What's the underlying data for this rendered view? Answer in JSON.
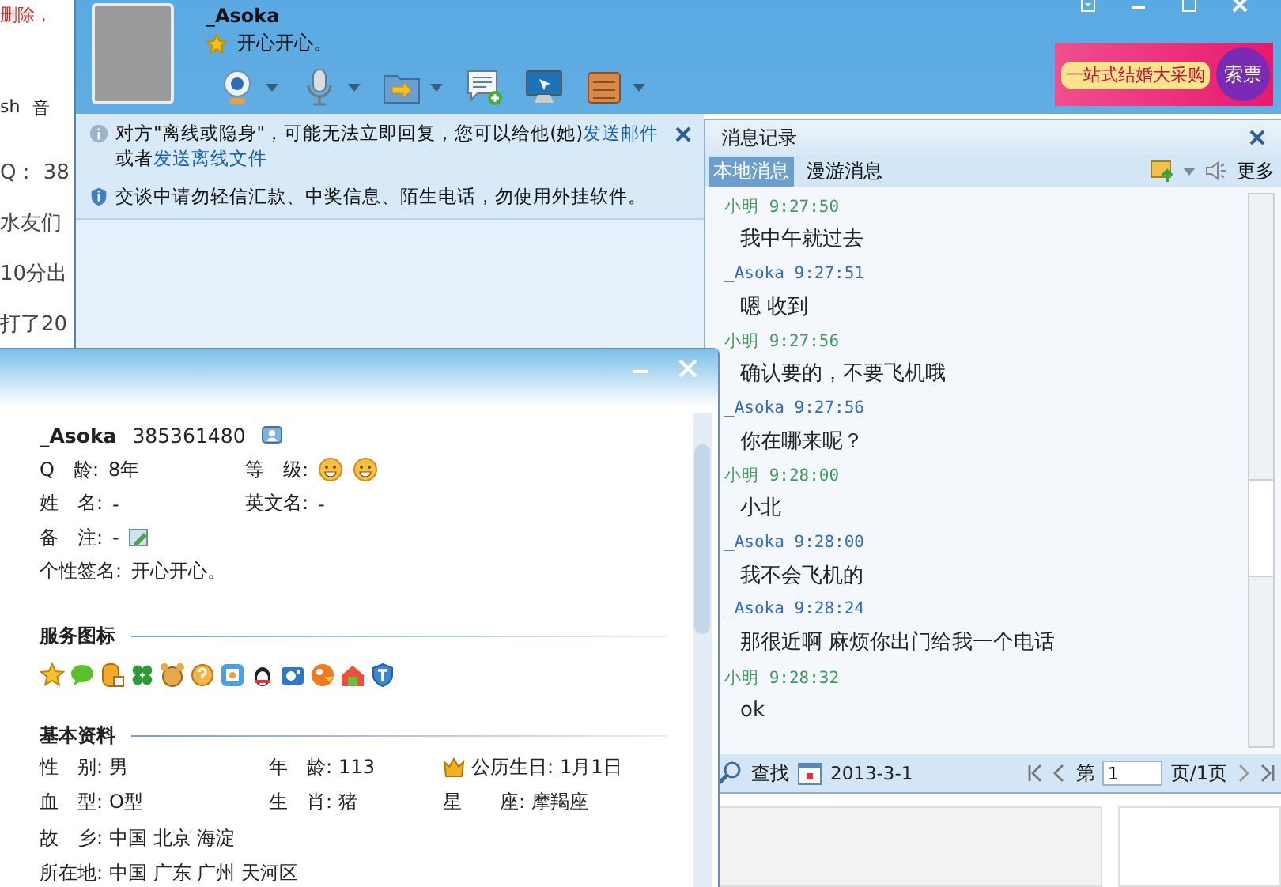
{
  "background_page": {
    "fragments": [
      "删除，",
      "sh",
      "音",
      "Q： 38",
      "水友们",
      "10分出",
      "打了20"
    ]
  },
  "chat_window": {
    "contact": {
      "name": "_Asoka",
      "signature": "开心开心。"
    },
    "ad": {
      "slogan": "一站式结婚大采购",
      "button": "索票"
    },
    "notices": [
      {
        "kind": "info",
        "parts": [
          {
            "text": "对方\"离线或隐身\"，可能无法立即回复，您可以给他(她)",
            "link": false
          },
          {
            "text": "发送邮件",
            "link": true
          },
          {
            "text": "或者",
            "link": false
          },
          {
            "text": "发送离线文件",
            "link": true
          }
        ]
      },
      {
        "kind": "security",
        "parts": [
          {
            "text": "交谈中请勿轻信汇款、中奖信息、陌生电话，勿使用外挂软件。",
            "link": false
          }
        ]
      }
    ],
    "history": {
      "title": "消息记录",
      "tabs": [
        {
          "label": "本地消息",
          "selected": true
        },
        {
          "label": "漫游消息",
          "selected": false
        }
      ],
      "more": "更多",
      "messages": [
        {
          "kind": "peer",
          "sender": "小明",
          "time": "9:27:50",
          "text": "我中午就过去"
        },
        {
          "kind": "me",
          "sender": "_Asoka",
          "time": "9:27:51",
          "text": "嗯 收到"
        },
        {
          "kind": "peer",
          "sender": "小明",
          "time": "9:27:56",
          "text": "确认要的，不要飞机哦"
        },
        {
          "kind": "me",
          "sender": "_Asoka",
          "time": "9:27:56",
          "text": "你在哪来呢？"
        },
        {
          "kind": "peer",
          "sender": "小明",
          "time": "9:28:00",
          "text": "小北"
        },
        {
          "kind": "me",
          "sender": "_Asoka",
          "time": "9:28:00",
          "text": "我不会飞机的"
        },
        {
          "kind": "me",
          "sender": "_Asoka",
          "time": "9:28:24",
          "text": "那很近啊 麻烦你出门给我一个电话"
        },
        {
          "kind": "peer",
          "sender": "小明",
          "time": "9:28:32",
          "text": "ok"
        }
      ],
      "footer": {
        "find": "查找",
        "date": "2013-3-1",
        "page_prefix": "第",
        "page": "1",
        "page_suffix": "页/1页"
      }
    }
  },
  "profile_window": {
    "name": "_Asoka",
    "number": "385361480",
    "fields": [
      [
        {
          "label": "Q　龄:",
          "value": "8年",
          "kind": "text"
        },
        {
          "label": "等　级:",
          "kind": "level"
        }
      ],
      [
        {
          "label": "姓　名:",
          "value": "-",
          "kind": "text"
        },
        {
          "label": "英文名:",
          "value": "-",
          "kind": "text"
        }
      ],
      [
        {
          "label": "备　注:",
          "value": "-",
          "kind": "editable"
        }
      ],
      [
        {
          "label": "个性签名:",
          "value": "开心开心。",
          "kind": "text"
        }
      ]
    ],
    "services_title": "服务图标",
    "basic_title": "基本资料",
    "basic": [
      [
        {
          "label": "性　别:",
          "value": "男",
          "kind": "text"
        },
        {
          "label": "年　龄:",
          "value": "113",
          "kind": "text"
        },
        {
          "label": "公历生日:",
          "value": "1月1日",
          "kind": "crown"
        }
      ],
      [
        {
          "label": "血　型:",
          "value": "O型",
          "kind": "text"
        },
        {
          "label": "生　肖:",
          "value": "猪",
          "kind": "text"
        },
        {
          "label": "星　　座:",
          "value": "摩羯座",
          "kind": "text"
        }
      ],
      [
        {
          "label": "故　乡:",
          "value": "中国 北京 海淀",
          "kind": "text"
        }
      ],
      [
        {
          "label": "所在地:",
          "value": "中国 广东 广州 天河区",
          "kind": "text"
        }
      ]
    ]
  }
}
